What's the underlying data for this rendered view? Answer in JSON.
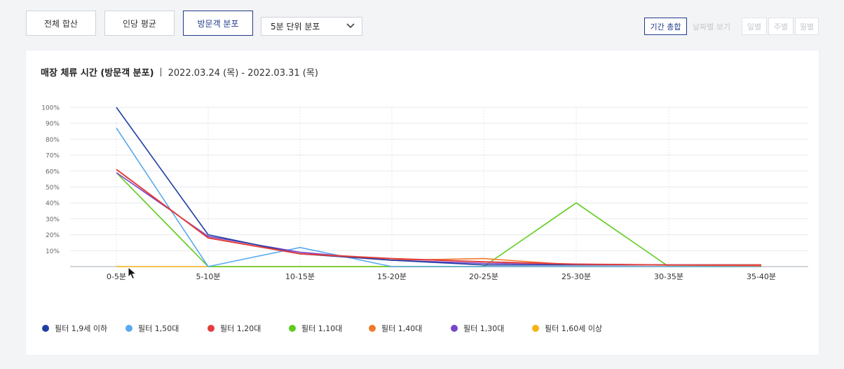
{
  "toolbar": {
    "tabs": [
      {
        "label": "전체 합산",
        "active": false
      },
      {
        "label": "인당 평균",
        "active": false
      },
      {
        "label": "방문객 분포",
        "active": true
      }
    ],
    "select_value": "5분 단위 분포",
    "right": [
      {
        "label": "기간 총합",
        "state": "active"
      },
      {
        "label": "날짜별 보기",
        "state": "disabled"
      },
      {
        "label": "일별",
        "state": "disabled"
      },
      {
        "label": "주별",
        "state": "disabled"
      },
      {
        "label": "월별",
        "state": "disabled"
      }
    ]
  },
  "header": {
    "title": "매장 체류 시간 (방문객 분포)",
    "separator": "|",
    "date_range": "2022.03.24 (목) - 2022.03.31 (목)"
  },
  "colors": {
    "accent": "#1f3a8a",
    "grid": "#e6e9ee",
    "axis": "#b7bcc6"
  },
  "chart_data": {
    "type": "line",
    "categories": [
      "0-5분",
      "5-10분",
      "10-15분",
      "15-20분",
      "20-25분",
      "25-30분",
      "30-35분",
      "35-40분"
    ],
    "ylim": [
      0,
      100
    ],
    "yticks": [
      "10%",
      "20%",
      "30%",
      "40%",
      "50%",
      "60%",
      "70%",
      "80%",
      "90%",
      "100%"
    ],
    "grid": true,
    "legend_position": "bottom",
    "series": [
      {
        "name": "필터 1,60세 이상",
        "color": "#f5b316",
        "values": [
          0,
          0,
          0,
          0,
          0,
          0,
          0,
          0
        ]
      },
      {
        "name": "필터 1,10대",
        "color": "#5fcc1e",
        "values": [
          59,
          0,
          0,
          0,
          0,
          40,
          0,
          0
        ]
      },
      {
        "name": "필터 1,50대",
        "color": "#5aaaf0",
        "values": [
          87,
          0,
          12,
          0,
          0,
          0,
          0,
          0
        ]
      },
      {
        "name": "필터 1,40대",
        "color": "#ef7b2e",
        "values": [
          61,
          18,
          8,
          4,
          5,
          1,
          1,
          0.5
        ]
      },
      {
        "name": "필터 1,30대",
        "color": "#7a46c9",
        "values": [
          59,
          19,
          9,
          4,
          2,
          1.5,
          1,
          1
        ]
      },
      {
        "name": "필터 1,9세 이하",
        "color": "#1f3fa3",
        "values": [
          100,
          20,
          8,
          4,
          1,
          1,
          1,
          1
        ]
      },
      {
        "name": "필터 1,20대",
        "color": "#e23d3d",
        "values": [
          61,
          18,
          8,
          5,
          3,
          1.5,
          1,
          1
        ]
      }
    ],
    "legend_order": [
      "필터 1,9세 이하",
      "필터 1,50대",
      "필터 1,20대",
      "필터 1,10대",
      "필터 1,40대",
      "필터 1,30대",
      "필터 1,60세 이상"
    ]
  }
}
